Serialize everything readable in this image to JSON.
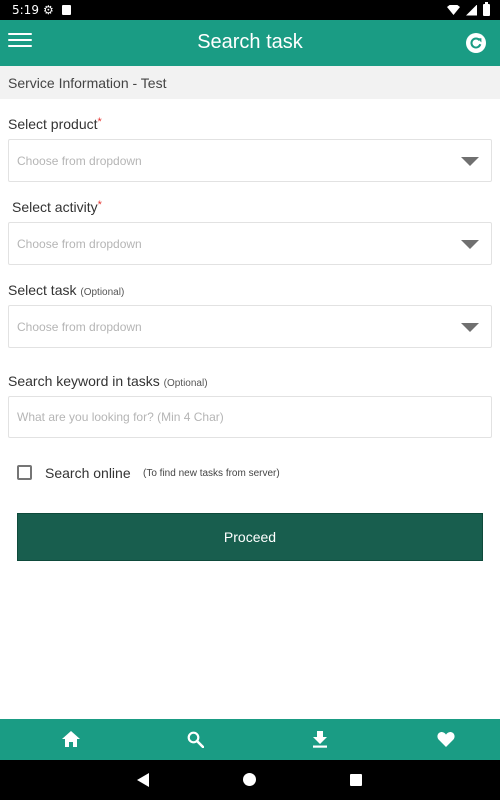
{
  "status_bar": {
    "time": "5:19",
    "icons": [
      "gear-icon",
      "sd-card-icon",
      "wifi-icon",
      "signal-icon",
      "battery-icon"
    ]
  },
  "app_bar": {
    "title": "Search task",
    "left_icon": "menu-icon",
    "right_icon": "refresh-icon",
    "color": "#1a9c84"
  },
  "subheader": {
    "text": "Service Information - Test"
  },
  "form": {
    "product": {
      "label": "Select product",
      "required_mark": "*",
      "placeholder": "Choose from dropdown"
    },
    "activity": {
      "label": "Select activity",
      "required_mark": "*",
      "placeholder": "Choose from dropdown"
    },
    "task": {
      "label": "Select task",
      "optional_text": "(Optional)",
      "placeholder": "Choose from dropdown"
    },
    "keyword": {
      "label": "Search keyword in tasks",
      "optional_text": "(Optional)",
      "placeholder": "What are you looking for? (Min 4 Char)",
      "value": ""
    },
    "search_online": {
      "label": "Search online",
      "hint": "(To find new tasks from server)",
      "checked": false
    },
    "proceed_label": "Proceed",
    "proceed_color": "#185e4e"
  },
  "bottom_nav": {
    "items": [
      "home-icon",
      "search-icon",
      "download-icon",
      "heart-icon"
    ]
  },
  "system_nav": {
    "items": [
      "back-icon",
      "home-circle-icon",
      "recents-icon"
    ]
  }
}
